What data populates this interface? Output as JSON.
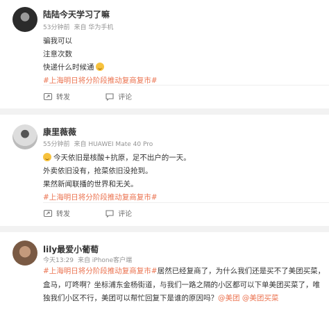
{
  "comments": [
    {
      "user": "陆陆今天学习了嘛",
      "time": "53分钟前",
      "source": "来自 华为手机",
      "lines": [
        "骗我可以",
        "注意次数",
        "快递什么时候通"
      ],
      "topic": "#上海明日将分阶段推动复商复市#",
      "share_label": "转发",
      "comment_label": "评论"
    },
    {
      "user": "康里薇薇",
      "time": "55分钟前",
      "source": "来自 HUAWEI Mate 40 Pro",
      "lines": [
        "今天依旧是核酸+抗原，足不出户的一天。",
        "外卖依旧没有，抢菜依旧没抢到。",
        "果然新闻联播的世界和无关。"
      ],
      "topic": "#上海明日将分阶段推动复商复市#",
      "share_label": "转发",
      "comment_label": "评论"
    },
    {
      "user": "lily最爱小葡萄",
      "time": "今天13:29",
      "source": "来自 iPhone客户端",
      "topic": "#上海明日将分阶段推动复商复市#",
      "line1_rest": "居然已经复商了，为什么我们还是买不了美团买菜，",
      "line2": "盒马，叮咚啊？坐标浦东金杨街道，与我们一路之隔的小区都可以下单美团买菜了，唯",
      "line3_text": "独我们小区不行，美团可以帮忙回复下是谁的原因吗？",
      "mention1": "@美团",
      "mention2": "@美团买菜"
    }
  ]
}
